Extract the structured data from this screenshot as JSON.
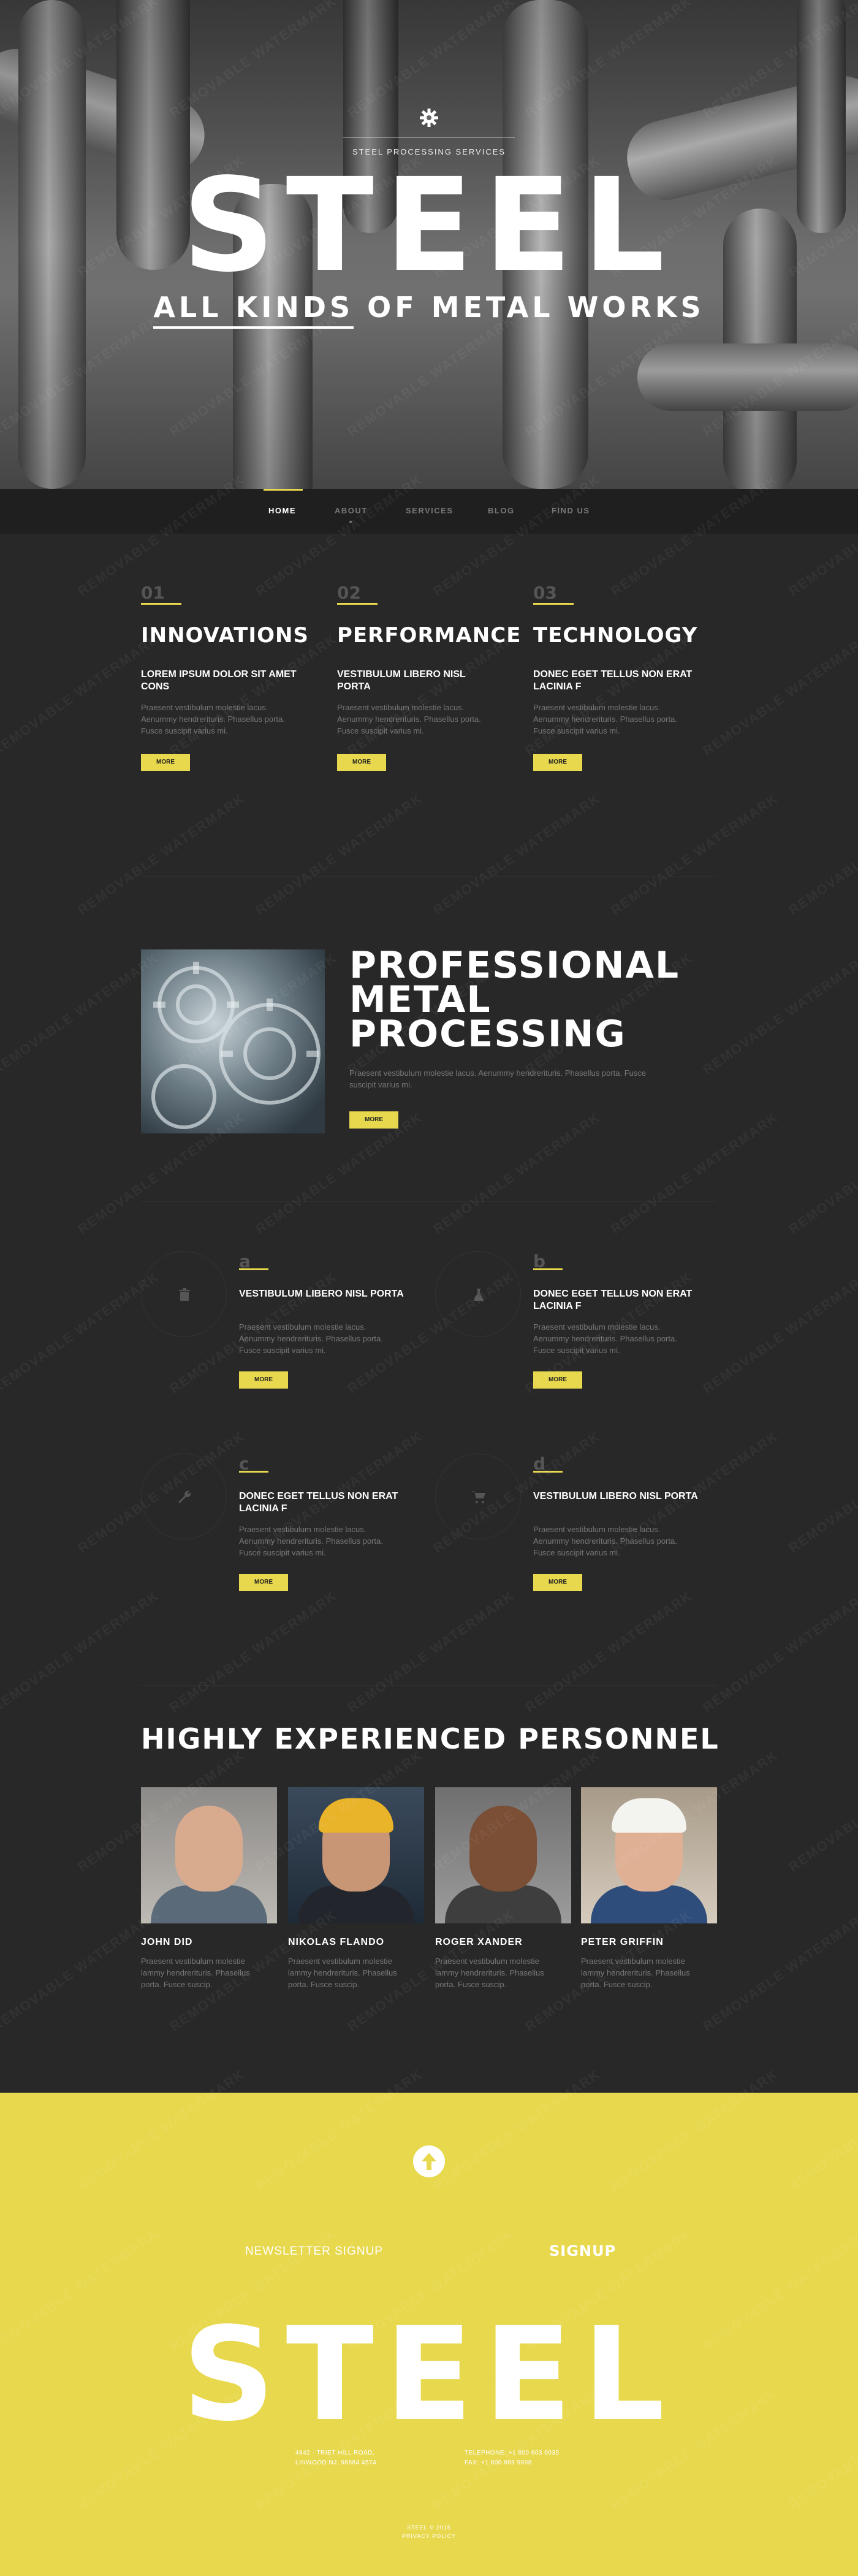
{
  "hero": {
    "subtitle": "STEEL PROCESSING SERVICES",
    "title": "STEEL",
    "tagline_underlined": "ALL KINDS",
    "tagline_rest": " OF METAL WORKS"
  },
  "nav": {
    "items": [
      {
        "label": "HOME",
        "active": true
      },
      {
        "label": "ABOUT"
      },
      {
        "label": "SERVICES"
      },
      {
        "label": "BLOG"
      },
      {
        "label": "FIND US"
      }
    ]
  },
  "features": [
    {
      "num": "01",
      "title": "INNOVATIONS",
      "sub": "LOREM IPSUM DOLOR SIT AMET CONS",
      "body": "Praesent vestibulum molestie lacus. Aenummy hendrerit­uris. Phasellus porta. Fusce suscipit varius mi.",
      "button": "MORE"
    },
    {
      "num": "02",
      "title": "PERFORMANCE",
      "sub": "VESTIBULUM LIBERO NISL PORTA",
      "body": "Praesent vestibulum molestie lacus. Aenummy hendrerit­uris. Phasellus porta. Fusce suscipit varius mi.",
      "button": "MORE"
    },
    {
      "num": "03",
      "title": "TECHNOLOGY",
      "sub": "DONEC EGET TELLUS NON ERAT LACINIA F",
      "body": "Praesent vestibulum molestie lacus. Aenummy hendrerit­uris. Phasellus porta. Fusce suscipit varius mi.",
      "button": "MORE"
    }
  ],
  "professional": {
    "title_line1": "PROFESSIONAL",
    "title_line2": "METAL",
    "title_line3": "PROCESSING",
    "body": "Praesent vestibulum molestie lacus. Aenummy hendrerit­uris. Phasellus porta. Fusce suscipit varius mi.",
    "button": "MORE"
  },
  "services": [
    {
      "letter": "a",
      "icon": "trash-icon",
      "sub": "VESTIBULUM LIBERO NISL PORTA",
      "body": "Praesent vestibulum molestie lacus. Aenummy hendrerit­uris. Phasellus porta. Fusce suscipit varius mi.",
      "button": "MORE"
    },
    {
      "letter": "b",
      "icon": "flask-icon",
      "sub": "DONEC EGET TELLUS NON ERAT LACINIA F",
      "body": "Praesent vestibulum molestie lacus. Aenummy hendrerit­uris. Phasellus porta. Fusce suscipit varius mi.",
      "button": "MORE"
    },
    {
      "letter": "c",
      "icon": "wrench-icon",
      "sub": "DONEC EGET TELLUS NON ERAT LACINIA F",
      "body": "Praesent vestibulum molestie lacus. Aenummy hendrerit­uris. Phasellus porta. Fusce suscipit varius mi.",
      "button": "MORE"
    },
    {
      "letter": "d",
      "icon": "cart-icon",
      "sub": "VESTIBULUM LIBERO NISL PORTA",
      "body": "Praesent vestibulum molestie lacus. Aenummy hendrerit­uris. Phasellus porta. Fusce suscipit varius mi.",
      "button": "MORE"
    }
  ],
  "personnel": {
    "title": "HIGHLY EXPERIENCED PERSONNEL",
    "people": [
      {
        "name": "JOHN DID",
        "body": "Praesent vestibulum molestie lammy hendrerit­uris. Phasellus porta. Fusce suscip."
      },
      {
        "name": "NIKOLAS FLANDO",
        "body": "Praesent vestibulum molestie lammy hendrerit­uris. Phasellus porta. Fusce suscip."
      },
      {
        "name": "ROGER XANDER",
        "body": "Praesent vestibulum molestie lammy hendrerit­uris. Phasellus porta. Fusce suscip."
      },
      {
        "name": "PETER GRIFFIN",
        "body": "Praesent vestibulum molestie lammy hendrerit­uris. Phasellus porta. Fusce suscip."
      }
    ]
  },
  "footer": {
    "newsletter_placeholder": "NEWSLETTER SIGNUP",
    "signup_label": "SIGNUP",
    "title": "STEEL",
    "address_line1": "4842 · TRIET HILL ROAD,",
    "address_line2": "LINWOOD NJ, 98684 4574",
    "phone_line1": "TELEPHONE: +1 800 603 6035",
    "phone_line2": "FAX:          +1 800 889 9898",
    "copy_line1": "STEEL © 2015",
    "copy_line2": "PRIVACY POLICY"
  },
  "colors": {
    "accent": "#e8d84e",
    "background": "#282828",
    "nav_bg": "#1f1f1f"
  },
  "watermark": "REMOVABLE WATERMARK"
}
